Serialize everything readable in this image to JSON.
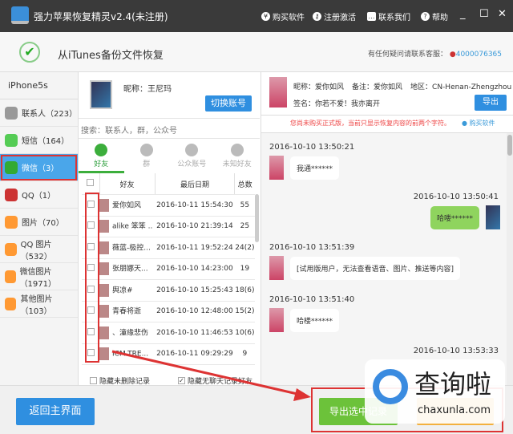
{
  "titlebar": {
    "title": "强力苹果恢复精灵v2.4(未注册)",
    "buttons": [
      {
        "label": "购买软件",
        "icon": "coin-icon"
      },
      {
        "label": "注册激活",
        "icon": "key-icon"
      },
      {
        "label": "联系我们",
        "icon": "chat-icon"
      },
      {
        "label": "帮助",
        "icon": "help-icon"
      }
    ]
  },
  "header": {
    "title": "从iTunes备份文件恢复",
    "support_label": "有任何疑问请联系客服：",
    "support_qq": "4000076365"
  },
  "sidebar": {
    "device": "iPhone5s",
    "items": [
      {
        "label": "联系人（223）",
        "color": "#999"
      },
      {
        "label": "短信（164）",
        "color": "#5c5"
      },
      {
        "label": "微信（3）",
        "color": "#3a3",
        "active": true
      },
      {
        "label": "QQ（1）",
        "color": "#c33"
      },
      {
        "label": "图片（70）",
        "color": "#f93"
      },
      {
        "label": "QQ 图片（532）",
        "color": "#f93"
      },
      {
        "label": "微信图片（1971）",
        "color": "#f93"
      },
      {
        "label": "其他图片（103）",
        "color": "#f93"
      }
    ]
  },
  "account": {
    "nickname": "昵称：王尼玛",
    "switch_label": "切换账号",
    "search_placeholder": "搜索：联系人，群，公众号"
  },
  "tabs": [
    {
      "label": "好友",
      "active": true
    },
    {
      "label": "群"
    },
    {
      "label": "公众账号"
    },
    {
      "label": "未知好友"
    }
  ],
  "table": {
    "headers": [
      "好友",
      "最后日期",
      "总数"
    ],
    "rows": [
      {
        "name": "爱你如风",
        "date": "2016-10-11 15:54:30",
        "count": "55"
      },
      {
        "name": "alike 笨笨 ..",
        "date": "2016-10-10 21:39:14",
        "count": "25"
      },
      {
        "name": "薇蓝-极控...",
        "date": "2016-10-11 19:52:24",
        "count": "24(2)"
      },
      {
        "name": "张朋娜天...",
        "date": "2016-10-10 14:23:00",
        "count": "19"
      },
      {
        "name": "舆凉#",
        "date": "2016-10-10 15:25:43",
        "count": "18(6)"
      },
      {
        "name": "青春将逝",
        "date": "2016-10-10 12:48:00",
        "count": "15(2)"
      },
      {
        "name": "、潼缘悲伤",
        "date": "2016-10-10 11:46:53",
        "count": "10(6)"
      },
      {
        "name": "ICM-TRE...",
        "date": "2016-10-11 09:29:29",
        "count": "9"
      }
    ]
  },
  "options": {
    "hide_undeleted": "隐藏未删除记录",
    "hide_empty": "隐藏无聊天记录好友"
  },
  "contact": {
    "nickname": "昵称：爱你如风",
    "remark": "备注：爱你如风",
    "region": "地区：CN-Henan-Zhengzhou",
    "signature": "签名：你若不爱！我亦离开",
    "export_label": "导出"
  },
  "notice": {
    "text": "您尚未购买正式版，当前只显示恢复内容的前两个字符。",
    "buy_label": "购买软件"
  },
  "messages": [
    {
      "time": "2016-10-10 13:50:21",
      "text": "我通******",
      "side": "left"
    },
    {
      "time": "2016-10-10 13:50:41",
      "text": "哈喽******",
      "side": "right"
    },
    {
      "time": "2016-10-10 13:51:39",
      "text": "[试用版用户，无法查看语音、图片、推送等内容]",
      "side": "left"
    },
    {
      "time": "2016-10-10 13:51:40",
      "text": "哈楼******",
      "side": "left"
    },
    {
      "time": "2016-10-10 13:53:33",
      "text": "",
      "side": "right"
    }
  ],
  "bottom": {
    "back_label": "返回主界面",
    "export_selected_label": "导出选中记录"
  },
  "watermark": {
    "brand": "查询啦",
    "domain": "chaxunla.com"
  }
}
